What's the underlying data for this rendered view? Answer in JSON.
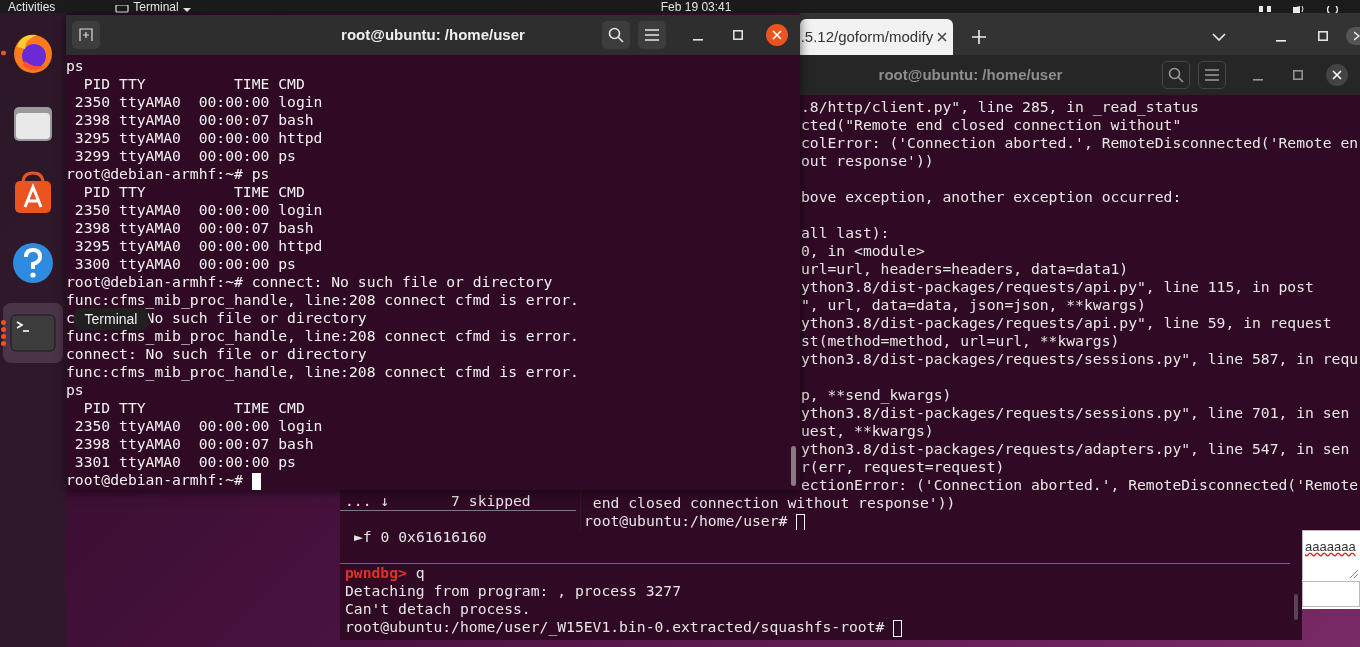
{
  "top_bar": {
    "activities": "Activities",
    "app_name": "Terminal",
    "clock": "Feb 19  03:41"
  },
  "dock": {
    "items": [
      {
        "kind": "firefox",
        "running": true,
        "selected": false
      },
      {
        "kind": "files",
        "running": false,
        "selected": false
      },
      {
        "kind": "software",
        "running": false,
        "selected": false
      },
      {
        "kind": "help",
        "running": false,
        "selected": false
      },
      {
        "kind": "terminal",
        "running": true,
        "selected": true
      }
    ],
    "tooltip": "Terminal"
  },
  "browser": {
    "tab_title": ".5.12/goform/modify",
    "field_value": "aaaaaaa"
  },
  "main_terminal": {
    "title": "root@ubuntu: /home/user",
    "active": true,
    "blocks": [
      [
        "ps",
        "  PID TTY          TIME CMD",
        " 2350 ttyAMA0  00:00:00 login",
        " 2398 ttyAMA0  00:00:07 bash",
        " 3295 ttyAMA0  00:00:00 httpd",
        " 3299 ttyAMA0  00:00:00 ps",
        "root@debian-armhf:~# ps",
        "  PID TTY          TIME CMD",
        " 2350 ttyAMA0  00:00:00 login",
        " 2398 ttyAMA0  00:00:07 bash",
        " 3295 ttyAMA0  00:00:00 httpd",
        " 3300 ttyAMA0  00:00:00 ps",
        "root@debian-armhf:~# connect: No such file or directory",
        "func:cfms_mib_proc_handle, line:208 connect cfmd is error.",
        [
          "c",
          "No such file or directory"
        ],
        "func:cfms_mib_proc_handle, line:208 connect cfmd is error.",
        "connect: No such file or directory",
        "func:cfms_mib_proc_handle, line:208 connect cfmd is error.",
        "ps",
        "  PID TTY          TIME CMD",
        " 2350 ttyAMA0  00:00:00 login",
        " 2398 ttyAMA0  00:00:07 bash",
        " 3301 ttyAMA0  00:00:00 ps",
        "root@debian-armhf:~# "
      ]
    ]
  },
  "back_terminal": {
    "title": "root@ubuntu: /home/user",
    "active": false,
    "blocks": [
      [
        ".8/http/client.py\", line 285, in _read_status",
        "cted(\"Remote end closed connection without\"",
        "colError: ('Connection aborted.', RemoteDisconnected('Remote en",
        "out response'))"
      ],
      [
        "bove exception, another exception occurred:"
      ],
      [
        "all last):",
        "0, in <module>",
        "url=url, headers=headers, data=data1)",
        "ython3.8/dist-packages/requests/api.py\", line 115, in post",
        "\", url, data=data, json=json, **kwargs)",
        "ython3.8/dist-packages/requests/api.py\", line 59, in request",
        "st(method=method, url=url, **kwargs)",
        "ython3.8/dist-packages/requests/sessions.py\", line 587, in requ"
      ],
      [
        "p, **send_kwargs)",
        "ython3.8/dist-packages/requests/sessions.py\", line 701, in sen",
        "uest, **kwargs)",
        "ython3.8/dist-packages/requests/adapters.py\", line 547, in sen",
        "r(err, request=request)",
        "ectionError: ('Connection aborted.', RemoteDisconnected('Remote"
      ]
    ],
    "tail_lines": [
      " end closed connection without response'))",
      "root@ubuntu:/home/user# "
    ]
  },
  "debugger_terminal": {
    "skipped": "... ↓       7 skipped",
    "frame": "►f 0 0x61616160",
    "prompt": "pwndbg>",
    "command": " q",
    "lines": [
      "Detaching from program: , process 3277",
      "Can't detach process.",
      "root@ubuntu:/home/user/_W15EV1.bin-0.extracted/squashfs-root# "
    ]
  }
}
